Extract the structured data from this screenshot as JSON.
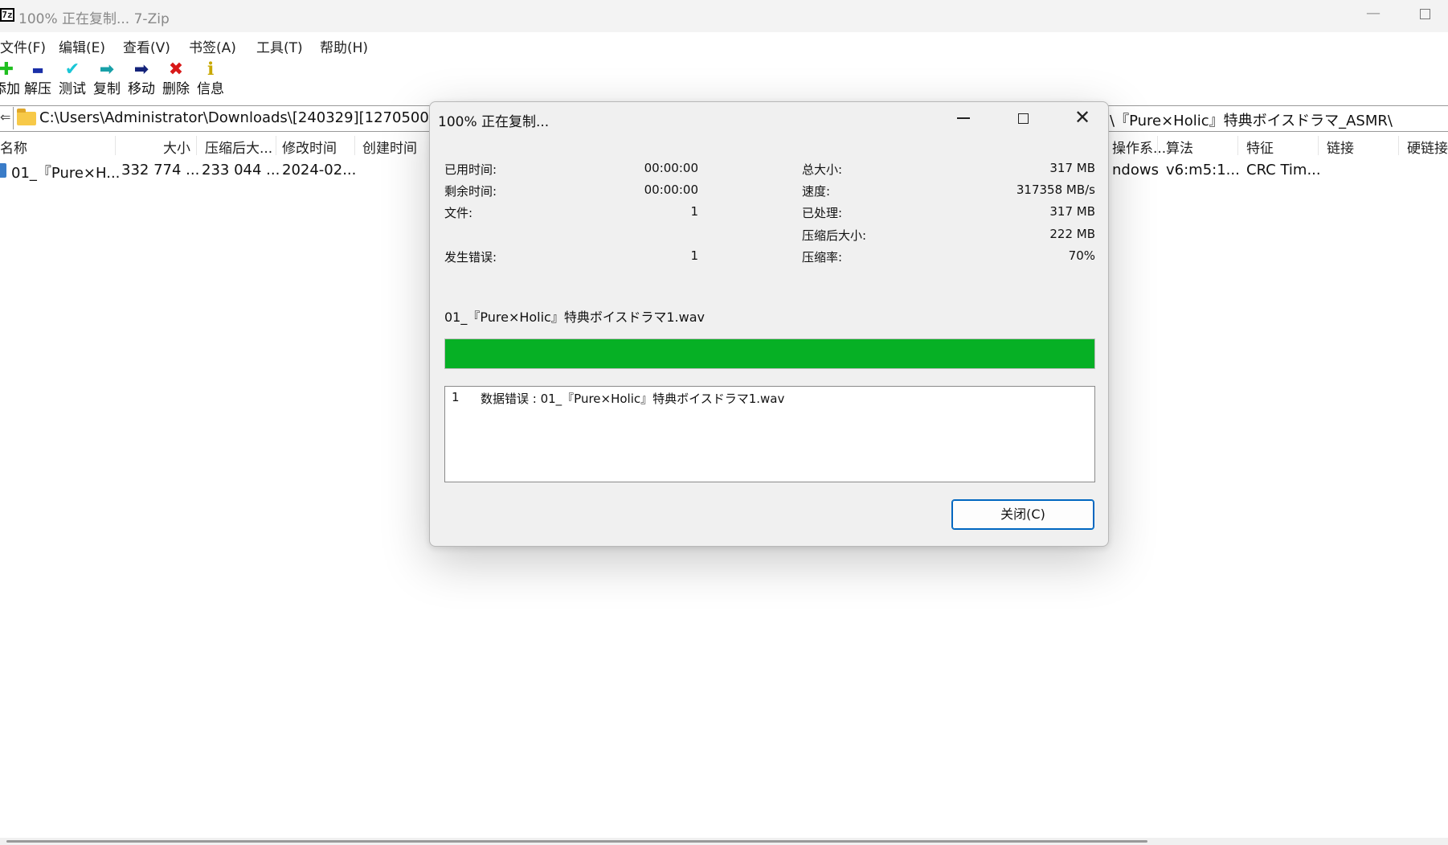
{
  "window": {
    "logo_text": "7z",
    "title": "100% 正在复制... 7-Zip",
    "min_glyph": "—"
  },
  "menu": [
    "文件(F)",
    "编辑(E)",
    "查看(V)",
    "书签(A)",
    "工具(T)",
    "帮助(H)"
  ],
  "toolbar": [
    {
      "label": "添加",
      "icon": "plus-icon",
      "glyph": "✚",
      "color": "#1fbf1f"
    },
    {
      "label": "解压",
      "icon": "minus-icon",
      "glyph": "▬",
      "color": "#1a2fa8"
    },
    {
      "label": "测试",
      "icon": "check-icon",
      "glyph": "✔",
      "color": "#1ac6d6"
    },
    {
      "label": "复制",
      "icon": "copy-arrow-icon",
      "glyph": "➡",
      "color": "#18a0a8"
    },
    {
      "label": "移动",
      "icon": "move-arrow-icon",
      "glyph": "➡",
      "color": "#14237a"
    },
    {
      "label": "删除",
      "icon": "delete-x-icon",
      "glyph": "✖",
      "color": "#d81818"
    },
    {
      "label": "信息",
      "icon": "info-icon",
      "glyph": "ℹ",
      "color": "#c8a800"
    }
  ],
  "address": {
    "left_arrow": "⇐",
    "path_visible_left": "C:\\Users\\Administrator\\Downloads\\[240329][1270500][",
    "path_visible_right": "\\『Pure×Holic』特典ボイスドラマ_ASMR\\"
  },
  "columns_left": [
    "名称",
    "大小",
    "压缩后大...",
    "修改时间",
    "创建时间"
  ],
  "columns_right": [
    "操作系...",
    "算法",
    "特征",
    "链接",
    "硬链接"
  ],
  "file_row": {
    "name": "01_『Pure×H...",
    "size": "332 774 ...",
    "packed": "233 044 ...",
    "modified": "2024-02...",
    "host_os": "ndows",
    "method": "v6:m5:1...",
    "characteristics": "CRC Tim..."
  },
  "dialog": {
    "title": "100% 正在复制...",
    "close_glyph": "✕",
    "stats_left": [
      {
        "label": "已用时间:",
        "value": "00:00:00"
      },
      {
        "label": "剩余时间:",
        "value": "00:00:00"
      },
      {
        "label": "文件:",
        "value": "1"
      },
      {
        "label": "发生错误:",
        "value": "1"
      }
    ],
    "stats_right": [
      {
        "label": "总大小:",
        "value": "317 MB"
      },
      {
        "label": "速度:",
        "value": "317358 MB/s"
      },
      {
        "label": "已处理:",
        "value": "317 MB"
      },
      {
        "label": "压缩后大小:",
        "value": "222 MB"
      },
      {
        "label": "压缩率:",
        "value": "70%"
      }
    ],
    "current_file": "01_『Pure×Holic』特典ボイスドラマ1.wav",
    "progress": 1.0,
    "progress_color": "#06b025",
    "errors": [
      {
        "num": "1",
        "message": "数据错误 : 01_『Pure×Holic』特典ボイスドラマ1.wav"
      }
    ],
    "close_button": "关闭(C)"
  }
}
